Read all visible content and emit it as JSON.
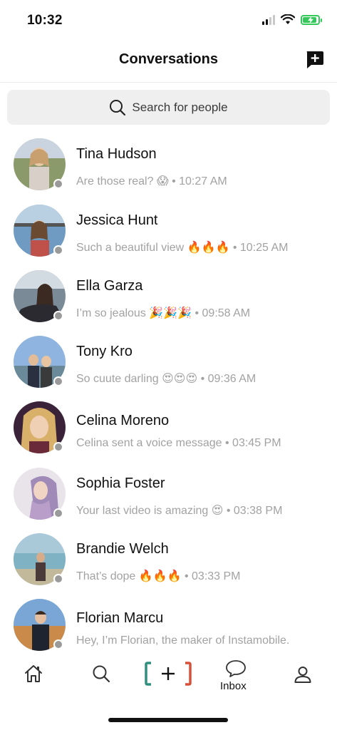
{
  "status_bar": {
    "time": "10:32",
    "battery_level": 0.9,
    "cellular_bars": 2,
    "colors": {
      "battery": "#34c759"
    }
  },
  "header": {
    "title": "Conversations",
    "compose_icon": "compose-message-icon"
  },
  "search": {
    "placeholder": "Search for people",
    "icon": "search-icon"
  },
  "conversations": [
    {
      "name": "Tina Hudson",
      "preview": "Are those real? 😱 • 10:27 AM"
    },
    {
      "name": "Jessica Hunt",
      "preview": "Such a beautiful view 🔥🔥🔥 • 10:25 AM"
    },
    {
      "name": "Ella Garza",
      "preview": "I’m so jealous 🎉🎉🎉 • 09:58 AM"
    },
    {
      "name": "Tony Kro",
      "preview": "So cuute darling 😍😍😍 • 09:36 AM"
    },
    {
      "name": "Celina Moreno",
      "preview": "Celina sent a voice message • 03:45 PM"
    },
    {
      "name": "Sophia Foster",
      "preview": "Your last video is amazing 😍 • 03:38 PM"
    },
    {
      "name": "Brandie Welch",
      "preview": "That’s dope 🔥🔥🔥 • 03:33 PM"
    },
    {
      "name": "Florian Marcu",
      "preview": "Hey, I’m Florian, the maker of Instamobile."
    }
  ],
  "tabs": [
    {
      "icon": "home-icon"
    },
    {
      "icon": "search-icon"
    },
    {
      "icon": "create-post-icon"
    },
    {
      "icon": "chat-bubble-icon",
      "label": "Inbox"
    },
    {
      "icon": "profile-icon"
    }
  ],
  "colors": {
    "presence_offline": "#9a9a9a",
    "accent_teal": "#2f8f7f",
    "accent_red": "#d8503a",
    "muted_text": "#a2a2a2"
  }
}
